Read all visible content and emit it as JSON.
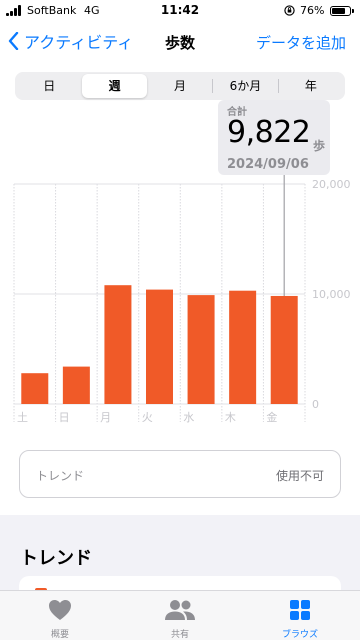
{
  "status_bar": {
    "carrier": "SoftBank",
    "network": "4G",
    "time": "11:42",
    "battery_percent": "76%",
    "battery_level": 0.76
  },
  "nav": {
    "back_label": "アクティビティ",
    "title": "歩数",
    "add_label": "データを追加"
  },
  "segments": [
    {
      "label": "日",
      "selected": false
    },
    {
      "label": "週",
      "selected": true
    },
    {
      "label": "月",
      "selected": false
    },
    {
      "label": "6か月",
      "selected": false
    },
    {
      "label": "年",
      "selected": false
    }
  ],
  "tooltip": {
    "title": "合計",
    "value": "9,822",
    "unit": "歩",
    "date": "2024/09/06"
  },
  "chart_data": {
    "type": "bar",
    "categories": [
      "土",
      "日",
      "月",
      "火",
      "水",
      "木",
      "金"
    ],
    "values": [
      2800,
      3400,
      10800,
      10400,
      9900,
      10300,
      9822
    ],
    "ylim": [
      0,
      20000
    ],
    "yticks": [
      0,
      10000,
      20000
    ],
    "ytick_labels": [
      "0",
      "10,000",
      "20,000"
    ],
    "selected_index": 6,
    "bar_color": "#f05a28",
    "grid": true
  },
  "trend_card": {
    "label": "トレンド",
    "status": "使用不可"
  },
  "section": {
    "heading": "トレンド"
  },
  "tab_bar": {
    "tabs": [
      {
        "label": "概要",
        "icon": "heart-icon",
        "active": false
      },
      {
        "label": "共有",
        "icon": "people-icon",
        "active": false
      },
      {
        "label": "ブラウズ",
        "icon": "grid-icon",
        "active": true
      }
    ]
  },
  "colors": {
    "accent": "#0a7aff",
    "bar": "#f05a28",
    "background": "#f2f2f7"
  }
}
